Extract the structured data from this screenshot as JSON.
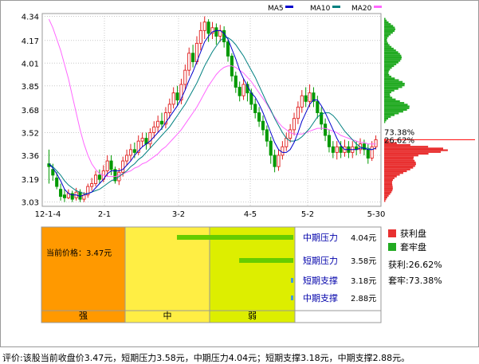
{
  "chart_data": [
    {
      "type": "candlestick",
      "x_ticks": [
        "12-1-4",
        "2-1",
        "3-2",
        "4-5",
        "5-2",
        "5-30"
      ],
      "y_ticks": [
        3.03,
        3.19,
        3.36,
        3.52,
        3.68,
        3.85,
        4.01,
        4.17,
        4.34
      ],
      "ylim": [
        3.0,
        4.36
      ],
      "legend": [
        {
          "name": "MA5",
          "color": "#0000cc"
        },
        {
          "name": "MA10",
          "color": "#008080"
        },
        {
          "name": "MA20",
          "color": "#ff66ff"
        }
      ],
      "candles": [
        [
          3.3,
          3.28,
          3.4,
          3.16
        ],
        [
          3.26,
          3.22,
          3.3,
          3.18
        ],
        [
          3.2,
          3.14,
          3.24,
          3.12
        ],
        [
          3.12,
          3.07,
          3.16,
          3.04
        ],
        [
          3.08,
          3.06,
          3.12,
          3.03
        ],
        [
          3.06,
          3.09,
          3.12,
          3.05
        ],
        [
          3.09,
          3.05,
          3.11,
          3.03
        ],
        [
          3.06,
          3.1,
          3.13,
          3.04
        ],
        [
          3.1,
          3.05,
          3.12,
          3.03
        ],
        [
          3.05,
          3.08,
          3.1,
          3.03
        ],
        [
          3.08,
          3.14,
          3.16,
          3.06
        ],
        [
          3.14,
          3.16,
          3.2,
          3.11
        ],
        [
          3.16,
          3.22,
          3.25,
          3.14
        ],
        [
          3.22,
          3.19,
          3.26,
          3.16
        ],
        [
          3.19,
          3.25,
          3.29,
          3.17
        ],
        [
          3.25,
          3.32,
          3.36,
          3.21
        ],
        [
          3.32,
          3.26,
          3.36,
          3.22
        ],
        [
          3.26,
          3.18,
          3.28,
          3.16
        ],
        [
          3.18,
          3.24,
          3.27,
          3.15
        ],
        [
          3.24,
          3.32,
          3.35,
          3.21
        ],
        [
          3.32,
          3.36,
          3.4,
          3.29
        ],
        [
          3.36,
          3.4,
          3.44,
          3.32
        ],
        [
          3.4,
          3.38,
          3.45,
          3.34
        ],
        [
          3.38,
          3.46,
          3.5,
          3.36
        ],
        [
          3.46,
          3.48,
          3.52,
          3.42
        ],
        [
          3.48,
          3.44,
          3.52,
          3.4
        ],
        [
          3.44,
          3.52,
          3.55,
          3.41
        ],
        [
          3.52,
          3.56,
          3.6,
          3.48
        ],
        [
          3.56,
          3.6,
          3.64,
          3.52
        ],
        [
          3.6,
          3.58,
          3.66,
          3.54
        ],
        [
          3.58,
          3.66,
          3.7,
          3.55
        ],
        [
          3.66,
          3.72,
          3.76,
          3.62
        ],
        [
          3.72,
          3.8,
          3.84,
          3.69
        ],
        [
          3.8,
          3.75,
          3.85,
          3.71
        ],
        [
          3.75,
          3.86,
          3.9,
          3.72
        ],
        [
          3.86,
          3.96,
          4.0,
          3.82
        ],
        [
          3.96,
          4.08,
          4.12,
          3.92
        ],
        [
          4.08,
          4.02,
          4.14,
          3.98
        ],
        [
          4.02,
          4.15,
          4.2,
          4.0
        ],
        [
          4.15,
          4.24,
          4.3,
          4.1
        ],
        [
          4.24,
          4.3,
          4.34,
          4.18
        ],
        [
          4.3,
          4.22,
          4.32,
          4.16
        ],
        [
          4.22,
          4.26,
          4.3,
          4.18
        ],
        [
          4.26,
          4.2,
          4.29,
          4.14
        ],
        [
          4.2,
          4.24,
          4.28,
          4.16
        ],
        [
          4.24,
          4.16,
          4.27,
          4.12
        ],
        [
          4.16,
          4.06,
          4.18,
          4.02
        ],
        [
          4.06,
          3.92,
          4.08,
          3.88
        ],
        [
          3.92,
          3.84,
          3.95,
          3.8
        ],
        [
          3.84,
          3.78,
          3.88,
          3.74
        ],
        [
          3.78,
          3.86,
          3.9,
          3.75
        ],
        [
          3.86,
          3.8,
          3.88,
          3.74
        ],
        [
          3.8,
          3.72,
          3.83,
          3.68
        ],
        [
          3.72,
          3.66,
          3.76,
          3.62
        ],
        [
          3.66,
          3.6,
          3.7,
          3.56
        ],
        [
          3.6,
          3.54,
          3.64,
          3.5
        ],
        [
          3.54,
          3.46,
          3.57,
          3.42
        ],
        [
          3.46,
          3.36,
          3.49,
          3.3
        ],
        [
          3.36,
          3.28,
          3.4,
          3.24
        ],
        [
          3.28,
          3.36,
          3.4,
          3.25
        ],
        [
          3.36,
          3.42,
          3.46,
          3.33
        ],
        [
          3.42,
          3.48,
          3.52,
          3.39
        ],
        [
          3.48,
          3.54,
          3.58,
          3.45
        ],
        [
          3.54,
          3.62,
          3.66,
          3.5
        ],
        [
          3.62,
          3.7,
          3.74,
          3.58
        ],
        [
          3.7,
          3.78,
          3.82,
          3.66
        ],
        [
          3.78,
          3.74,
          3.84,
          3.7
        ],
        [
          3.74,
          3.8,
          3.86,
          3.7
        ],
        [
          3.8,
          3.74,
          3.84,
          3.7
        ],
        [
          3.74,
          3.66,
          3.78,
          3.62
        ],
        [
          3.66,
          3.58,
          3.7,
          3.54
        ],
        [
          3.58,
          3.5,
          3.62,
          3.46
        ],
        [
          3.5,
          3.42,
          3.54,
          3.38
        ],
        [
          3.42,
          3.38,
          3.46,
          3.34
        ],
        [
          3.38,
          3.42,
          3.46,
          3.33
        ],
        [
          3.42,
          3.38,
          3.46,
          3.34
        ],
        [
          3.38,
          3.42,
          3.47,
          3.35
        ],
        [
          3.42,
          3.38,
          3.46,
          3.34
        ],
        [
          3.38,
          3.42,
          3.46,
          3.34
        ],
        [
          3.42,
          3.4,
          3.46,
          3.36
        ],
        [
          3.4,
          3.44,
          3.48,
          3.37
        ],
        [
          3.44,
          3.4,
          3.47,
          3.36
        ],
        [
          3.4,
          3.34,
          3.44,
          3.3
        ],
        [
          3.34,
          3.42,
          3.46,
          3.32
        ],
        [
          3.42,
          3.47,
          3.5,
          3.4
        ]
      ],
      "ma5": [
        3.3,
        3.27,
        3.23,
        3.18,
        3.12,
        3.09,
        3.08,
        3.08,
        3.07,
        3.08,
        3.09,
        3.1,
        3.13,
        3.16,
        3.19,
        3.23,
        3.25,
        3.25,
        3.25,
        3.26,
        3.29,
        3.32,
        3.36,
        3.39,
        3.42,
        3.44,
        3.46,
        3.49,
        3.52,
        3.55,
        3.59,
        3.63,
        3.67,
        3.71,
        3.76,
        3.82,
        3.89,
        3.95,
        4.02,
        4.09,
        4.16,
        4.2,
        4.23,
        4.24,
        4.24,
        4.22,
        4.18,
        4.11,
        4.04,
        3.96,
        3.9,
        3.85,
        3.8,
        3.77,
        3.72,
        3.66,
        3.59,
        3.52,
        3.45,
        3.4,
        3.38,
        3.38,
        3.4,
        3.45,
        3.52,
        3.6,
        3.66,
        3.72,
        3.75,
        3.75,
        3.71,
        3.66,
        3.6,
        3.54,
        3.48,
        3.43,
        3.4,
        3.4,
        3.4,
        3.4,
        3.41,
        3.41,
        3.4,
        3.4,
        3.41
      ],
      "ma10": [
        3.3,
        3.28,
        3.25,
        3.22,
        3.18,
        3.15,
        3.13,
        3.11,
        3.1,
        3.09,
        3.09,
        3.1,
        3.11,
        3.12,
        3.14,
        3.16,
        3.18,
        3.19,
        3.21,
        3.23,
        3.25,
        3.28,
        3.3,
        3.33,
        3.35,
        3.38,
        3.41,
        3.44,
        3.47,
        3.5,
        3.53,
        3.56,
        3.6,
        3.64,
        3.68,
        3.72,
        3.77,
        3.82,
        3.87,
        3.93,
        3.99,
        4.04,
        4.09,
        4.13,
        4.17,
        4.19,
        4.19,
        4.17,
        4.14,
        4.1,
        4.06,
        4.01,
        3.96,
        3.91,
        3.85,
        3.79,
        3.73,
        3.68,
        3.62,
        3.57,
        3.52,
        3.48,
        3.46,
        3.46,
        3.47,
        3.49,
        3.52,
        3.55,
        3.59,
        3.63,
        3.65,
        3.66,
        3.66,
        3.64,
        3.61,
        3.57,
        3.53,
        3.5,
        3.47,
        3.44,
        3.42,
        3.41,
        3.41,
        3.4,
        3.41
      ],
      "ma20": [
        4.32,
        4.26,
        4.18,
        4.1,
        4.0,
        3.9,
        3.78,
        3.66,
        3.54,
        3.44,
        3.36,
        3.3,
        3.26,
        3.23,
        3.22,
        3.21,
        3.21,
        3.21,
        3.22,
        3.23,
        3.24,
        3.25,
        3.27,
        3.28,
        3.3,
        3.31,
        3.33,
        3.35,
        3.37,
        3.4,
        3.42,
        3.45,
        3.48,
        3.51,
        3.54,
        3.58,
        3.62,
        3.66,
        3.7,
        3.75,
        3.8,
        3.85,
        3.89,
        3.93,
        3.96,
        3.98,
        3.99,
        3.99,
        3.98,
        3.96,
        3.94,
        3.91,
        3.88,
        3.84,
        3.8,
        3.76,
        3.72,
        3.67,
        3.63,
        3.59,
        3.56,
        3.54,
        3.52,
        3.51,
        3.51,
        3.51,
        3.52,
        3.53,
        3.54,
        3.55,
        3.55,
        3.55,
        3.54,
        3.53,
        3.52,
        3.5,
        3.49,
        3.48,
        3.47,
        3.46,
        3.45,
        3.45,
        3.44,
        3.44,
        3.44
      ],
      "chip_labels": [
        "73.38%",
        "26.62%"
      ]
    },
    {
      "type": "table",
      "columns": [
        "强",
        "中",
        "弱"
      ],
      "current_price": "当前价格：3.47元",
      "levels": [
        {
          "label": "中期压力",
          "value": "4.04元",
          "price": 4.04,
          "color": "#66cc00"
        },
        {
          "label": "短期压力",
          "value": "3.58元",
          "price": 3.58,
          "color": "#66cc00"
        },
        {
          "label": "短期支撑",
          "value": "3.18元",
          "price": 3.18,
          "color": "#4499dd"
        },
        {
          "label": "中期支撑",
          "value": "2.88元",
          "price": 2.88,
          "color": "#4499dd"
        }
      ]
    }
  ],
  "legend_panel": {
    "profit_label": "获利盘",
    "locked_label": "套牢盘",
    "profit_ratio": "获利:26.62%",
    "locked_ratio": "套牢:73.38%",
    "profit_color": "#e83030",
    "locked_color": "#22aa22"
  },
  "footer": "评价:该股当前收盘价3.47元，短期压力3.58元，中期压力4.04元；短期支撑3.18元，中期支撑2.88元。"
}
